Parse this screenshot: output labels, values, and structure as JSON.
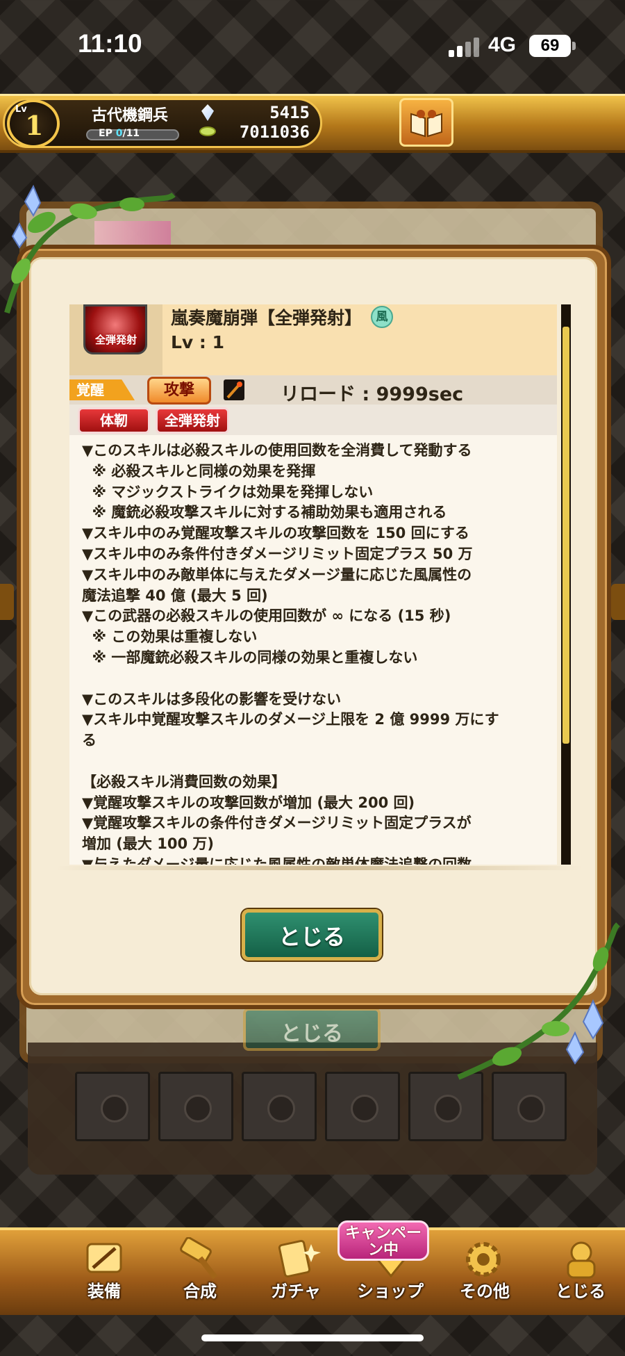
{
  "status_bar": {
    "time": "11:10",
    "network": "4G",
    "battery": "69"
  },
  "player": {
    "lv_label": "Lv",
    "level": "1",
    "name": "古代機鋼兵",
    "ep_label": "EP",
    "ep_current": "0",
    "ep_max": "/11",
    "gems": "5415",
    "coins": "7011036"
  },
  "background": {
    "close_label": "とじる"
  },
  "skill": {
    "icon_label": "全弾発射",
    "name": "嵐奏魔崩弾【全弾発射】",
    "element": "風",
    "level": "Lv : 1",
    "awaken_tag": "覚醒",
    "type_badge": "攻撃",
    "reload": "リロード : 9999sec",
    "tags": [
      "体靭",
      "全弾発射"
    ],
    "description_lines": [
      "▼このスキルは必殺スキルの使用回数を全消費して発動する",
      "  ※ 必殺スキルと同様の効果を発揮",
      "  ※ マジックストライクは効果を発揮しない",
      "  ※ 魔銃必殺攻撃スキルに対する補助効果も適用される",
      "▼スキル中のみ覚醒攻撃スキルの攻撃回数を 150 回にする",
      "▼スキル中のみ条件付きダメージリミット固定プラス 50 万",
      "▼スキル中のみ敵単体に与えたダメージ量に応じた風属性の",
      "魔法追撃 40 億 (最大 5 回)",
      "▼この武器の必殺スキルの使用回数が ∞ になる (15 秒)",
      "  ※ この効果は重複しない",
      "  ※ 一部魔銃必殺スキルの同様の効果と重複しない",
      "",
      "▼このスキルは多段化の影響を受けない",
      "▼スキル中覚醒攻撃スキルのダメージ上限を 2 億 9999 万にす",
      "る",
      "",
      "【必殺スキル消費回数の効果】",
      "▼覚醒攻撃スキルの攻撃回数が増加 (最大 200 回)",
      "▼覚醒攻撃スキルの条件付きダメージリミット固定プラスが",
      "増加 (最大 100 万)",
      "▼与えたダメージ量に応じた風属性の敵単体魔法追撃の回数"
    ]
  },
  "dialog": {
    "close_label": "とじる"
  },
  "nav": {
    "items": [
      {
        "label": "装備",
        "icon": "equipment-icon"
      },
      {
        "label": "合成",
        "icon": "hammer-icon"
      },
      {
        "label": "ガチャ",
        "icon": "gacha-icon"
      },
      {
        "label": "ショップ",
        "icon": "shop-icon"
      },
      {
        "label": "その他",
        "icon": "gear-icon"
      },
      {
        "label": "とじる",
        "icon": "close-icon"
      }
    ],
    "campaign_badge": "キャンペーン中"
  },
  "colors": {
    "gold": "#f2c24c",
    "frame": "#7c5220",
    "close_green": "#2f9070",
    "red_tag": "#e8383a"
  }
}
